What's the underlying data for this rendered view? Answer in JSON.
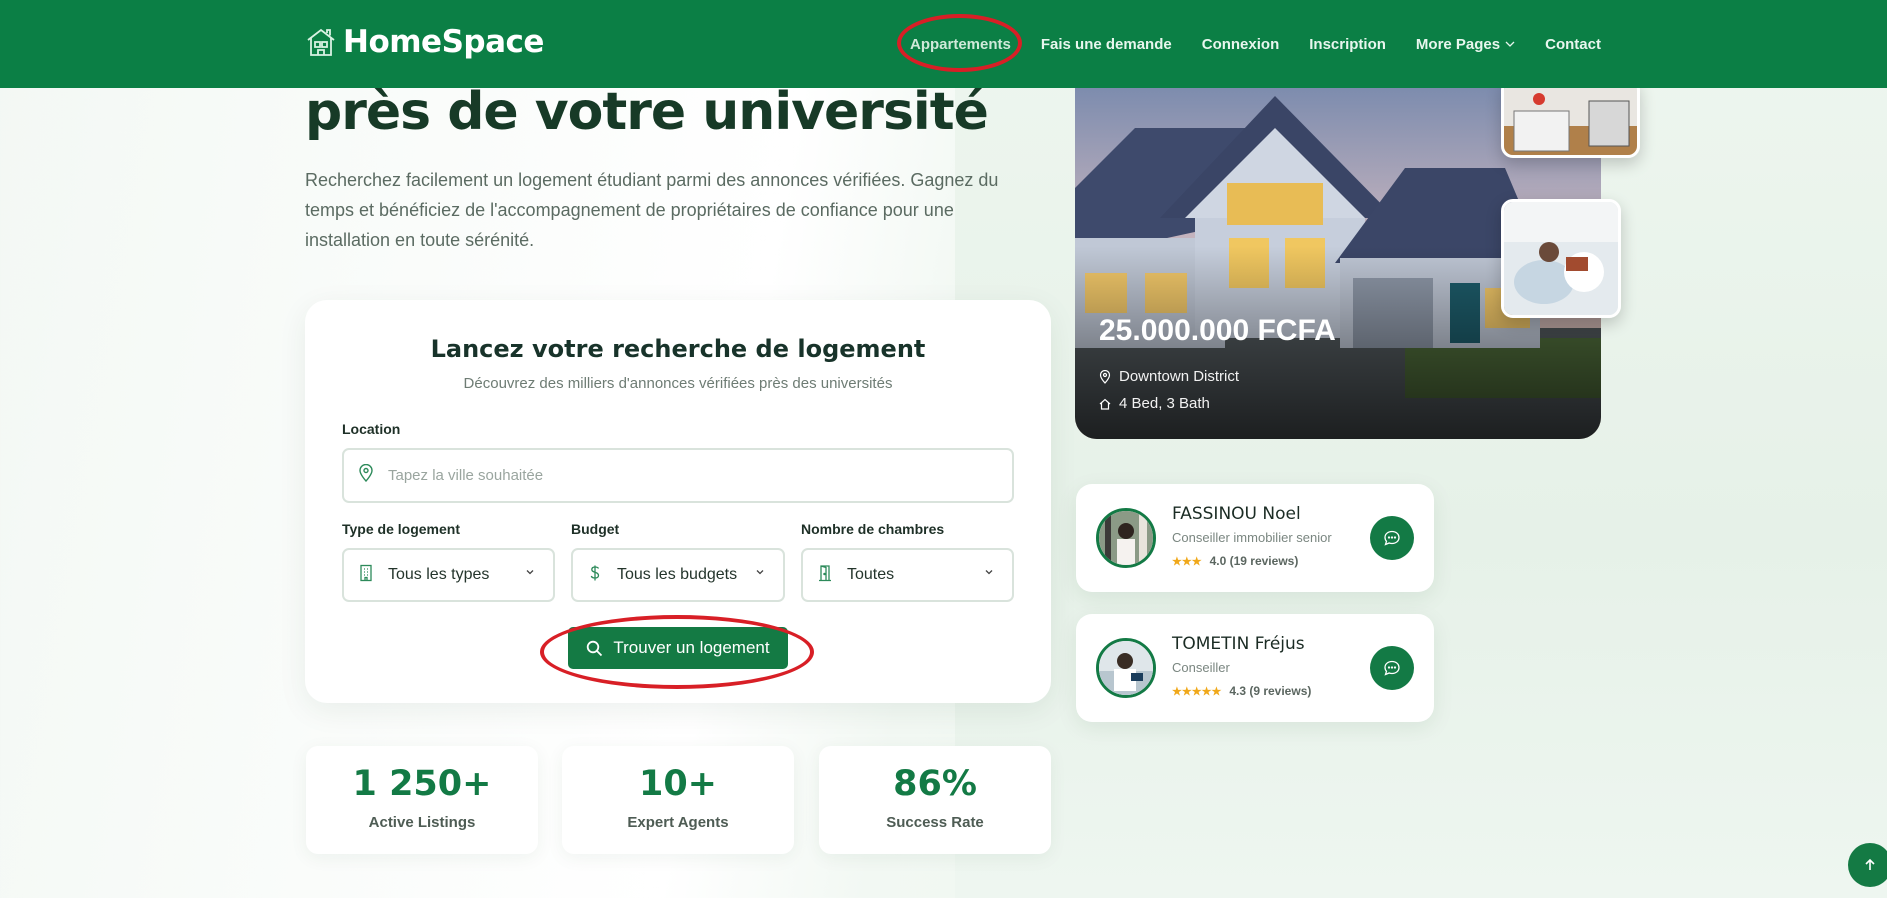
{
  "header": {
    "brand": "HomeSpace",
    "nav": [
      {
        "label": "Appartements"
      },
      {
        "label": "Fais une demande"
      },
      {
        "label": "Connexion"
      },
      {
        "label": "Inscription"
      },
      {
        "label": "More Pages"
      },
      {
        "label": "Contact"
      }
    ]
  },
  "hero": {
    "title": "près de votre université",
    "description": "Recherchez facilement un logement étudiant parmi des annonces vérifiées. Gagnez du temps et bénéficiez de l'accompagnement de propriétaires de confiance pour une installation en toute sérénité."
  },
  "search": {
    "title": "Lancez votre recherche de logement",
    "subtitle": "Découvrez des milliers d'annonces vérifiées près des universités",
    "location_label": "Location",
    "location_placeholder": "Tapez la ville souhaitée",
    "type_label": "Type de logement",
    "type_value": "Tous les types",
    "budget_label": "Budget",
    "budget_value": "Tous les budgets",
    "rooms_label": "Nombre de chambres",
    "rooms_value": "Toutes",
    "button_label": "Trouver un logement"
  },
  "stats": [
    {
      "value": "1 250+",
      "label": "Active Listings"
    },
    {
      "value": "10+",
      "label": "Expert Agents"
    },
    {
      "value": "86%",
      "label": "Success Rate"
    }
  ],
  "property": {
    "price": "25.000.000 FCFA",
    "location": "Downtown District",
    "details": "4 Bed, 3 Bath"
  },
  "agents": [
    {
      "name": "FASSINOU Noel",
      "role": "Conseiller immobilier senior",
      "stars": "★★★",
      "rating": "4.0 (19 reviews)"
    },
    {
      "name": "TOMETIN Fréjus",
      "role": "Conseiller",
      "stars": "★★★★★",
      "rating": "4.3 (9 reviews)"
    }
  ],
  "colors": {
    "brand_green": "#0b7f45",
    "accent_green": "#137a45",
    "highlight_red": "#d81f26",
    "star": "#f0a81a"
  }
}
